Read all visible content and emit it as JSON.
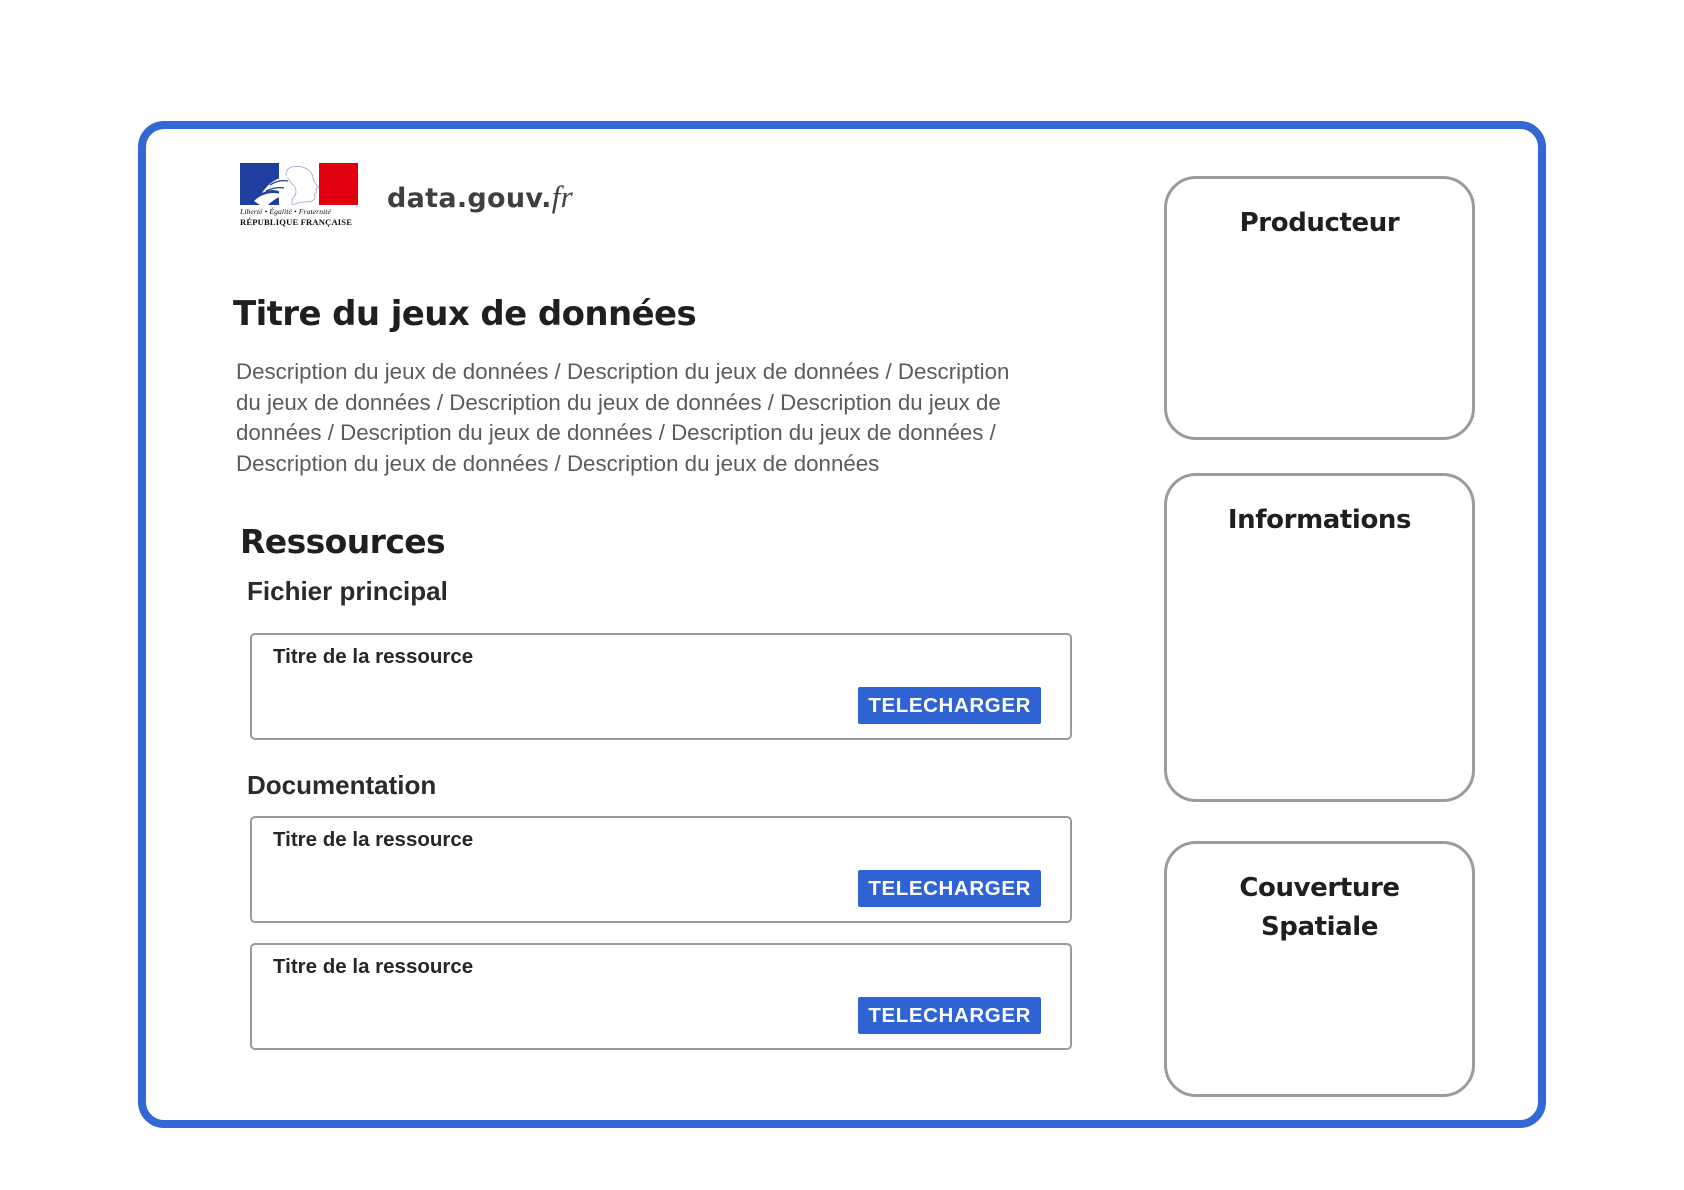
{
  "header": {
    "logo": {
      "motto": "Liberté • Égalité • Fraternité",
      "republique": "RÉPUBLIQUE FRANÇAISE",
      "colors": {
        "blue": "#1f3fa0",
        "red": "#e1000f"
      }
    },
    "brand": {
      "name": "data.gouv.",
      "tld": "fr"
    }
  },
  "dataset": {
    "title": "Titre du jeux de données",
    "description": "Description du jeux de données / Description du jeux de données / Description\ndu jeux de données / Description du jeux de données / Description du jeux de\ndonnées  / Description du jeux de données / Description du jeux de données /\nDescription du jeux de données / Description du jeux de données"
  },
  "resources": {
    "heading": "Ressources",
    "main": {
      "label": "Fichier principal",
      "items": [
        {
          "title": "Titre de la ressource",
          "button": "TELECHARGER"
        }
      ]
    },
    "documentation": {
      "label": "Documentation",
      "items": [
        {
          "title": "Titre de la ressource",
          "button": "TELECHARGER"
        },
        {
          "title": "Titre de la ressource",
          "button": "TELECHARGER"
        }
      ]
    }
  },
  "sidebar": {
    "producer": "Producteur",
    "informations": "Informations",
    "coverage": "Couverture\nSpatiale"
  },
  "colors": {
    "frame": "#3367d1",
    "button": "#2f62d3",
    "panel_border": "#9b9b9b"
  }
}
